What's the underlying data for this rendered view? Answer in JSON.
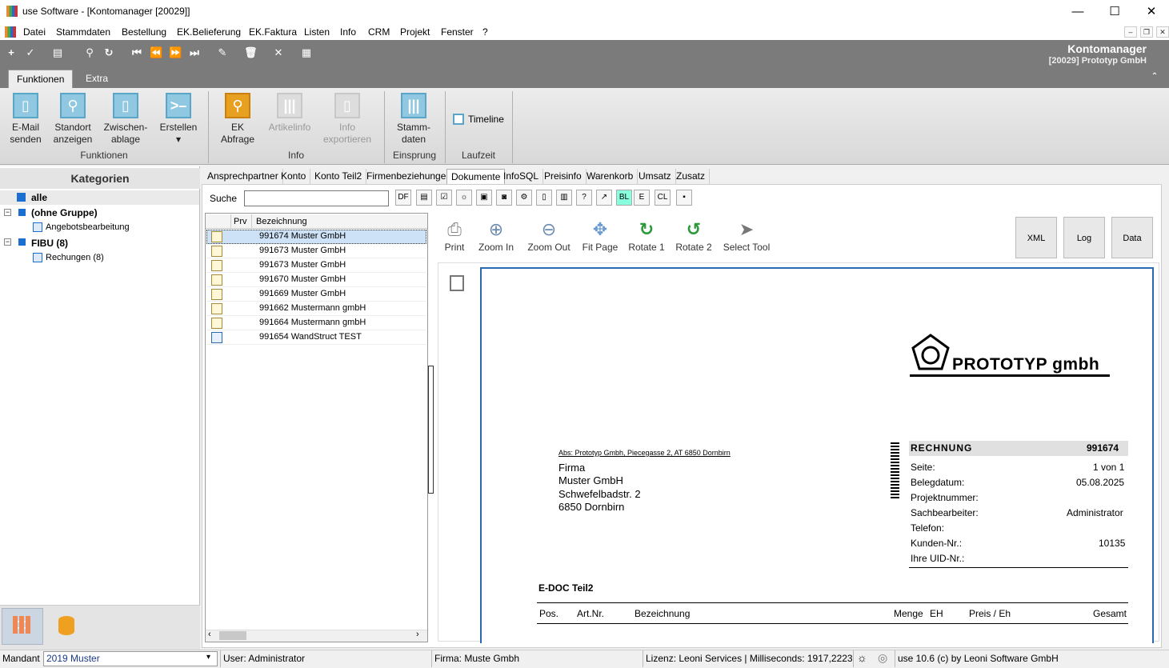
{
  "window": {
    "title": "use Software - [Kontomanager [20029]]",
    "minimize": "—",
    "maximize": "☐",
    "close": "✕"
  },
  "menu": [
    "Datei",
    "Stammdaten",
    "Bestellung",
    "EK.Belieferung",
    "EK.Faktura",
    "Listen",
    "Info",
    "CRM",
    "Projekt",
    "Fenster",
    "?"
  ],
  "mdi": {
    "min": "–",
    "restore": "❐",
    "close": "✕"
  },
  "header": {
    "title": "Kontomanager",
    "subtitle": "[20029] Prototyp GmbH"
  },
  "ribbon_tabs": [
    "Funktionen",
    "Extra"
  ],
  "ribbon": {
    "email": "E-Mail",
    "email2": "senden",
    "standort": "Standort",
    "standort2": "anzeigen",
    "zwischen": "Zwischen-",
    "zwischen2": "ablage",
    "erstellen": "Erstellen",
    "erstellen2": "▾",
    "group_funktionen": "Funktionen",
    "ek": "EK",
    "ek2": "Abfrage",
    "artikel": "Artikelinfo",
    "infoexp": "Info",
    "infoexp2": "exportieren",
    "group_info": "Info",
    "stamm": "Stamm-",
    "stamm2": "daten",
    "group_einsprung": "Einsprung",
    "timeline": "Timeline",
    "group_laufzeit": "Laufzeit"
  },
  "categories": {
    "header": "Kategorien",
    "all": "alle",
    "ohne": "(ohne Gruppe)",
    "angebot": "Angebotsbearbeitung",
    "fibu": "FIBU (8)",
    "rechnungen": "Rechungen (8)"
  },
  "main_tabs": [
    "Ansprechpartner",
    "Konto",
    "Konto Teil2",
    "Firmenbeziehungen",
    "Dokumente",
    "InfoSQL",
    "Preisinfo",
    "Warenkorb",
    "Umsatz",
    "Zusatz"
  ],
  "search": {
    "label": "Suche",
    "value": "",
    "btn_df": "DF",
    "btn_e": "E",
    "btn_cl": "CL"
  },
  "doclist": {
    "col_prv": "Prv",
    "col_bez": "Bezeichnung",
    "rows": [
      "991674 Muster GmbH",
      "991673 Muster GmbH",
      "991673 Muster GmbH",
      "991670 Muster GmbH",
      "991669 Muster GmbH",
      "991662 Mustermann gmbH",
      "991664 Mustermann gmbH",
      "991654 WandStruct TEST"
    ]
  },
  "viewer_tools": [
    "Print",
    "Zoom In",
    "Zoom Out",
    "Fit Page",
    "Rotate 1",
    "Rotate 2",
    "Select Tool"
  ],
  "viewer_buttons": [
    "XML",
    "Log",
    "Data"
  ],
  "invoice": {
    "logo": "PROTOTYP gmbh",
    "sender": "Abs: Prototyp Gmbh, Piecegasse 2, AT 6850 Dornbirn",
    "addr": [
      "Firma",
      "Muster GmbH",
      "Schwefelbadstr. 2",
      "6850 Dornbirn"
    ],
    "doc_type": "RECHNUNG",
    "doc_no": "991674",
    "fields": [
      {
        "k": "Seite:",
        "v": "1 von 1"
      },
      {
        "k": "Belegdatum:",
        "v": "05.08.2025"
      },
      {
        "k": "Projektnummer:",
        "v": ""
      },
      {
        "k": "Sachbearbeiter:",
        "v": "Administrator"
      },
      {
        "k": "Telefon:",
        "v": ""
      },
      {
        "k": "Kunden-Nr.:",
        "v": "10135"
      },
      {
        "k": "Ihre UID-Nr.:",
        "v": ""
      }
    ],
    "section": "E-DOC Teil2",
    "cols": [
      "Pos.",
      "Art.Nr.",
      "Bezeichnung",
      "Menge",
      "EH",
      "Preis / Eh",
      "Gesamt"
    ]
  },
  "status": {
    "mandant_label": "Mandant",
    "mandant_value": "2019 Muster",
    "user": "User: Administrator",
    "firma": "Firma: Muste Gmbh",
    "lizenz": "Lizenz: Leoni Services | Milliseconds: 1917,2223",
    "version": "use 10.6 (c) by Leoni Software GmbH"
  },
  "colors": {
    "accent": "#1a6fd0",
    "toolbar": "#7b7b7b",
    "page_border": "#2a6ab0"
  }
}
